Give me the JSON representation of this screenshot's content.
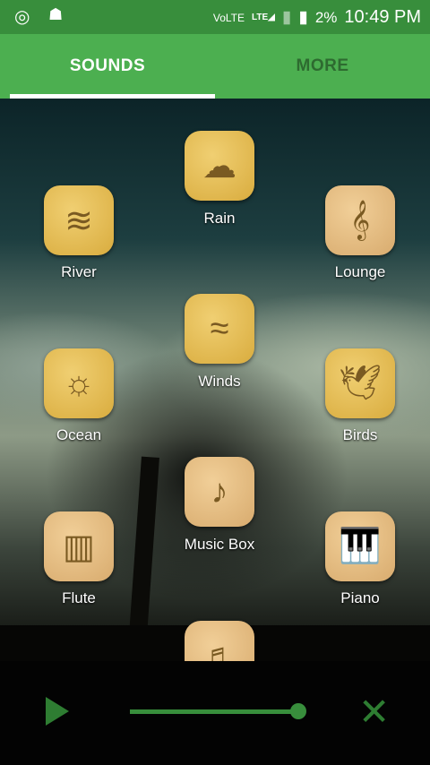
{
  "status": {
    "network": "VoLTE",
    "lte": "LTE",
    "battery": "2%",
    "time": "10:49 PM"
  },
  "tabs": [
    {
      "label": "SOUNDS"
    },
    {
      "label": "MORE"
    }
  ],
  "sounds": [
    {
      "label": "Rain"
    },
    {
      "label": "River"
    },
    {
      "label": "Lounge"
    },
    {
      "label": "Winds"
    },
    {
      "label": "Ocean"
    },
    {
      "label": "Birds"
    },
    {
      "label": "Music Box"
    },
    {
      "label": "Flute"
    },
    {
      "label": "Piano"
    }
  ],
  "player": {
    "volume_percent": 100
  },
  "colors": {
    "primary": "#4caf50",
    "dark": "#388e3c"
  }
}
